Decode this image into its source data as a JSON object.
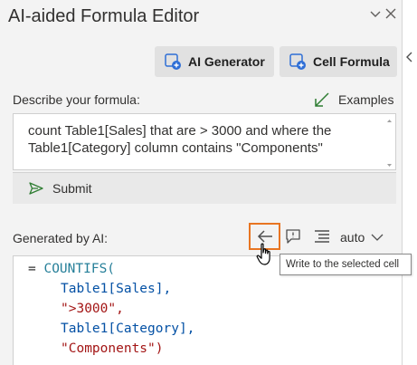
{
  "pane": {
    "title": "AI-aided Formula Editor"
  },
  "toolbar": {
    "ai_generator_label": "AI Generator",
    "cell_formula_label": "Cell Formula"
  },
  "prompt": {
    "label": "Describe your formula:",
    "examples_label": "Examples",
    "text": "count Table1[Sales] that are > 3000 and where the Table1[Category] column contains \"Components\"",
    "submit_label": "Submit"
  },
  "result": {
    "label": "Generated by AI:",
    "mode_value": "auto",
    "tooltip": "Write to the selected cell",
    "formula": {
      "eq": "= ",
      "fn": "COUNTIFS(",
      "arg1": "Table1[Sales],",
      "arg2": "\">3000\",",
      "arg3": "Table1[Category],",
      "arg4": "\"Components\")"
    }
  },
  "colors": {
    "accent_blue": "#2f6fd6",
    "highlight_orange": "#e87522",
    "pane_bg": "#f3f3f3",
    "examples_arrow": "#2e7d32"
  },
  "icons": [
    "chevron-down-icon",
    "close-icon",
    "chevron-left-icon",
    "ai-generator-icon",
    "cell-formula-icon",
    "examples-arrow-icon",
    "send-icon",
    "arrow-left-icon",
    "comment-icon",
    "align-icon",
    "pointer-hand-icon"
  ]
}
